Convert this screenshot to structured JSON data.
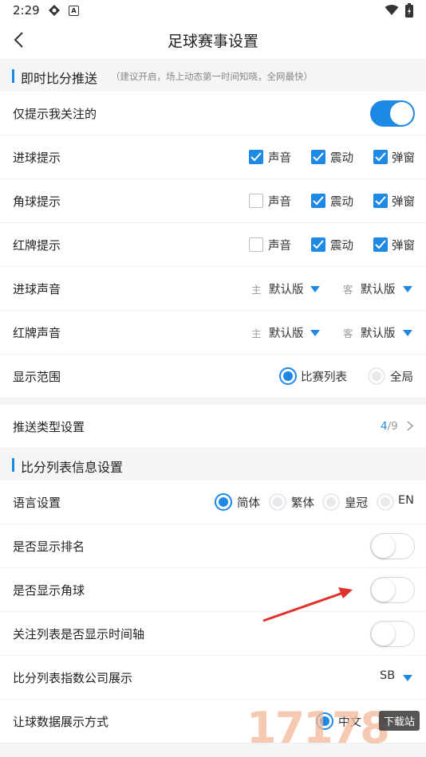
{
  "status_bar": {
    "time": "2:29",
    "icon_names": [
      "game-icon",
      "a-badge-icon",
      "wifi-icon",
      "battery-icon"
    ]
  },
  "header": {
    "title": "足球赛事设置"
  },
  "section1": {
    "title": "即时比分推送",
    "note": "（建议开启，场上动态第一时间知晓，全网最快）"
  },
  "only_followed": {
    "label": "仅提示我关注的",
    "enabled": true
  },
  "options": {
    "sound": "声音",
    "vibrate": "震动",
    "popup": "弹窗"
  },
  "goal_alert": {
    "label": "进球提示",
    "sound": true,
    "vibrate": true,
    "popup": true
  },
  "corner_alert": {
    "label": "角球提示",
    "sound": false,
    "vibrate": true,
    "popup": true
  },
  "red_card_alert": {
    "label": "红牌提示",
    "sound": false,
    "vibrate": true,
    "popup": true
  },
  "goal_sound": {
    "label": "进球声音",
    "home_prefix": "主",
    "home_value": "默认版",
    "away_prefix": "客",
    "away_value": "默认版"
  },
  "red_card_sound": {
    "label": "红牌声音",
    "home_prefix": "主",
    "home_value": "默认版",
    "away_prefix": "客",
    "away_value": "默认版"
  },
  "display_range": {
    "label": "显示范围",
    "options": [
      "比赛列表",
      "全局"
    ],
    "selected": "比赛列表"
  },
  "push_types": {
    "label": "推送类型设置",
    "current": "4",
    "total": "/9"
  },
  "section2": {
    "title": "比分列表信息设置"
  },
  "language": {
    "label": "语言设置",
    "options": [
      "简体",
      "繁体",
      "皇冠",
      "EN"
    ],
    "selected": "简体"
  },
  "show_rank": {
    "label": "是否显示排名",
    "enabled": false
  },
  "show_corner": {
    "label": "是否显示角球",
    "enabled": false
  },
  "show_timeline": {
    "label": "关注列表是否显示时间轴",
    "enabled": false
  },
  "index_company": {
    "label": "比分列表指数公司展示",
    "value": "SB"
  },
  "handicap_display": {
    "label": "让球数据展示方式",
    "selected_option": "中文"
  },
  "watermark": {
    "digits": "17178",
    "badge": "下载站"
  },
  "colors": {
    "accent": "#1e88e5",
    "annotation_arrow": "#e0312a"
  }
}
